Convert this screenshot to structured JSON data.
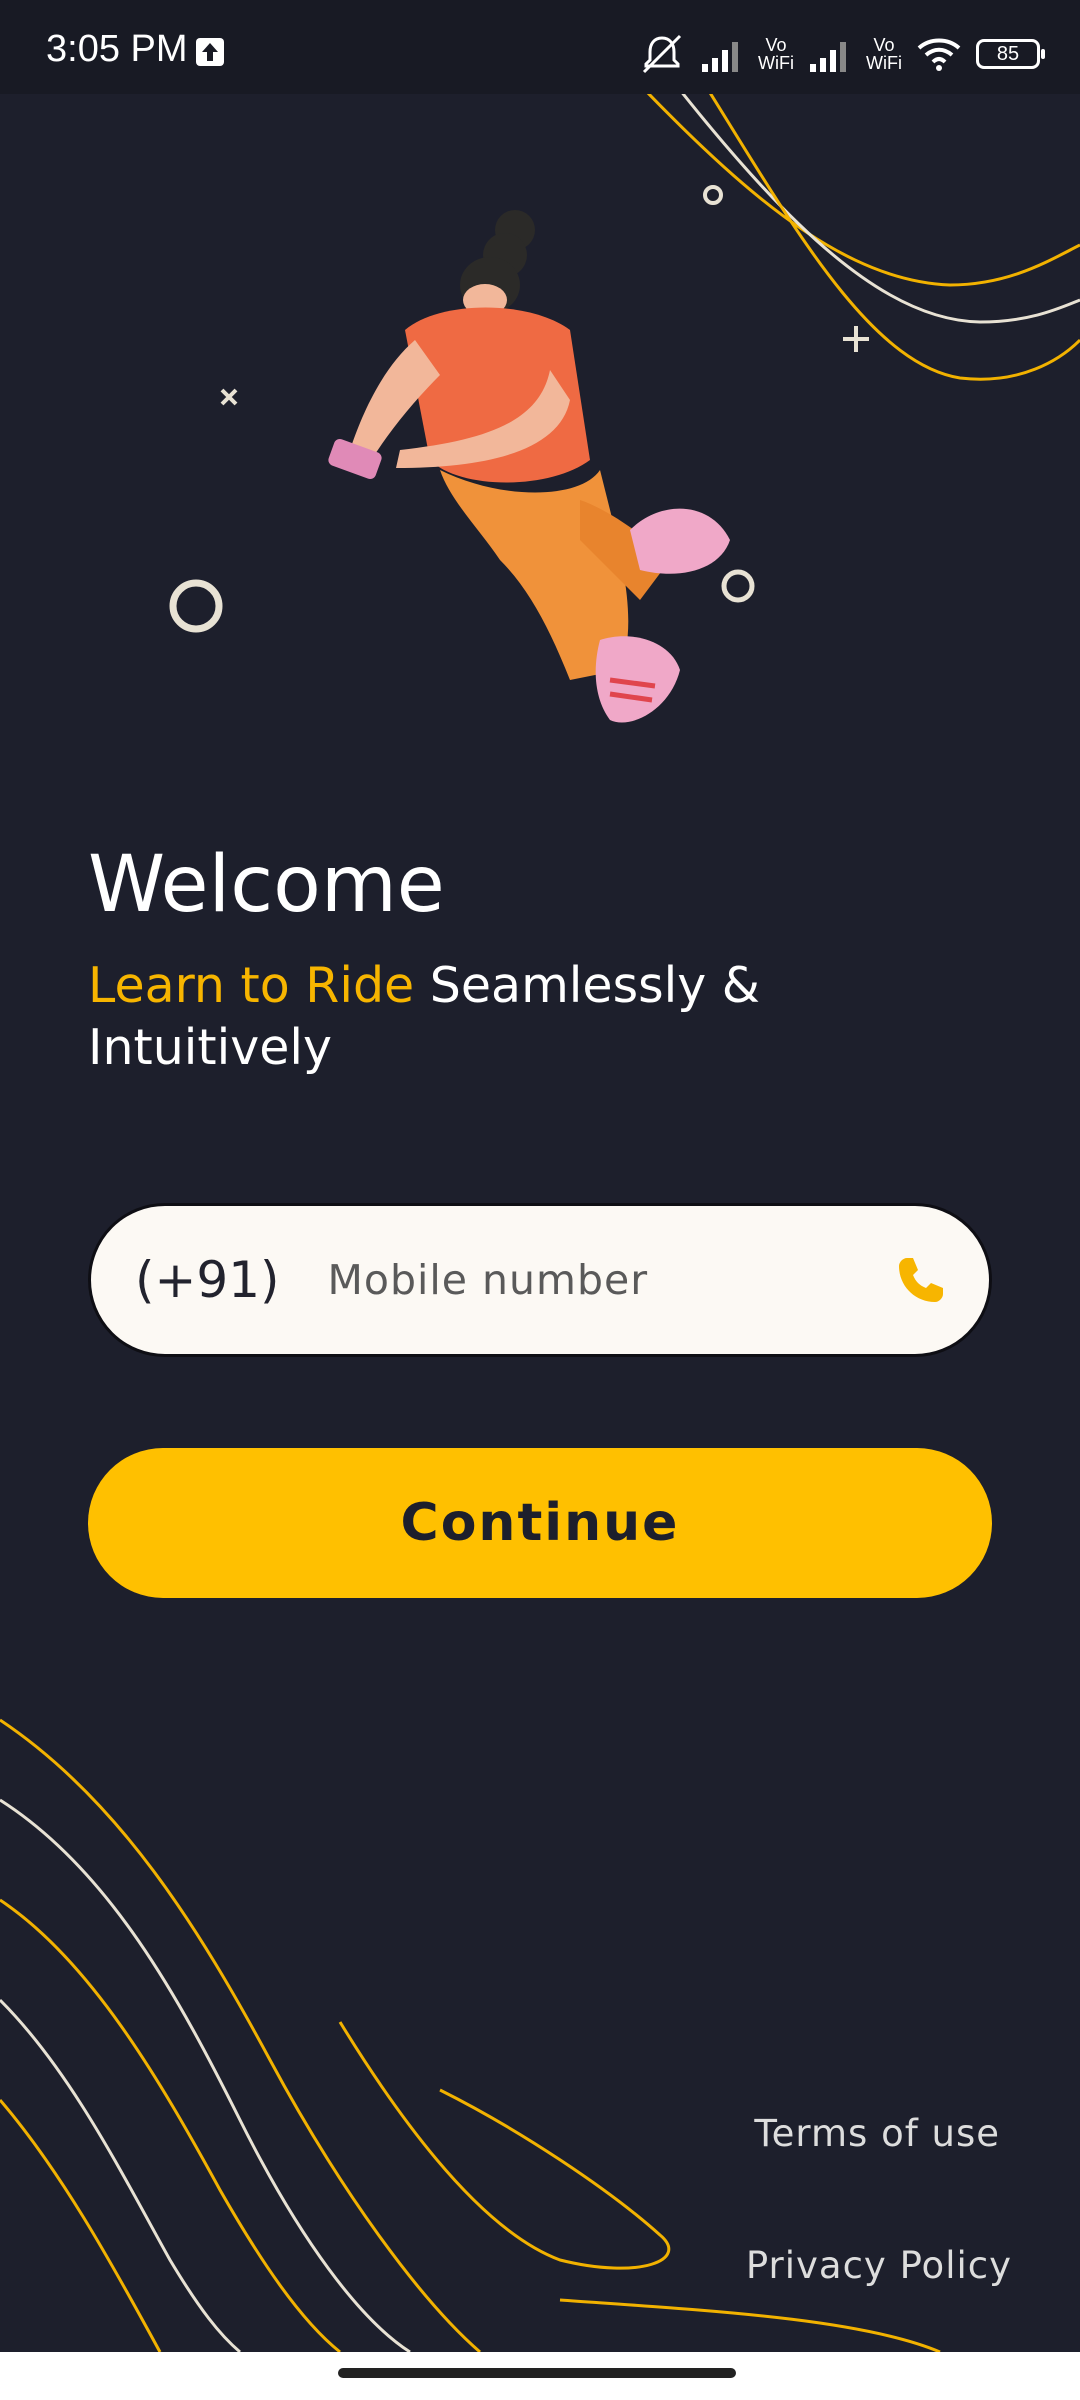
{
  "status_bar": {
    "time": "3:05 PM",
    "battery": "85",
    "vowifi_1": "Vo\nWiFi",
    "vowifi_2": "Vo\nWiFi"
  },
  "colors": {
    "background": "#1d1f2c",
    "accent": "#ffc000",
    "highlight_text": "#f7b500",
    "input_bg": "#fcf9f4"
  },
  "hero": {
    "title": "Welcome",
    "tagline_highlight": "Learn to Ride",
    "tagline_rest": " Seamlessly & Intuitively"
  },
  "phone_input": {
    "country_code": "(+91)",
    "placeholder": "Mobile number",
    "icon": "phone-icon"
  },
  "actions": {
    "continue_label": "Continue"
  },
  "footer": {
    "terms_label": "Terms of use",
    "privacy_label": "Privacy Policy"
  }
}
